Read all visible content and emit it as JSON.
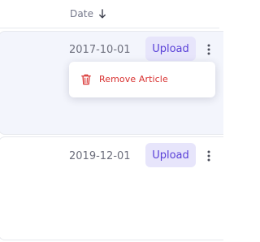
{
  "header": {
    "date_label": "Date",
    "sort_icon": "arrow-down-icon"
  },
  "rows": [
    {
      "date": "2017-10-01",
      "upload_label": "Upload",
      "menu_icon": "kebab-icon",
      "selected": true
    },
    {
      "date": "2019-12-01",
      "upload_label": "Upload",
      "menu_icon": "kebab-icon",
      "selected": false
    }
  ],
  "dropdown": {
    "items": [
      {
        "label": "Remove Article",
        "icon": "trash-icon"
      }
    ]
  },
  "colors": {
    "accent": "#5a41d8",
    "accent_bg": "#e7e5fb",
    "danger": "#d8302f",
    "selected_row_bg": "#f3f5fc",
    "border": "#e7e9ee"
  }
}
